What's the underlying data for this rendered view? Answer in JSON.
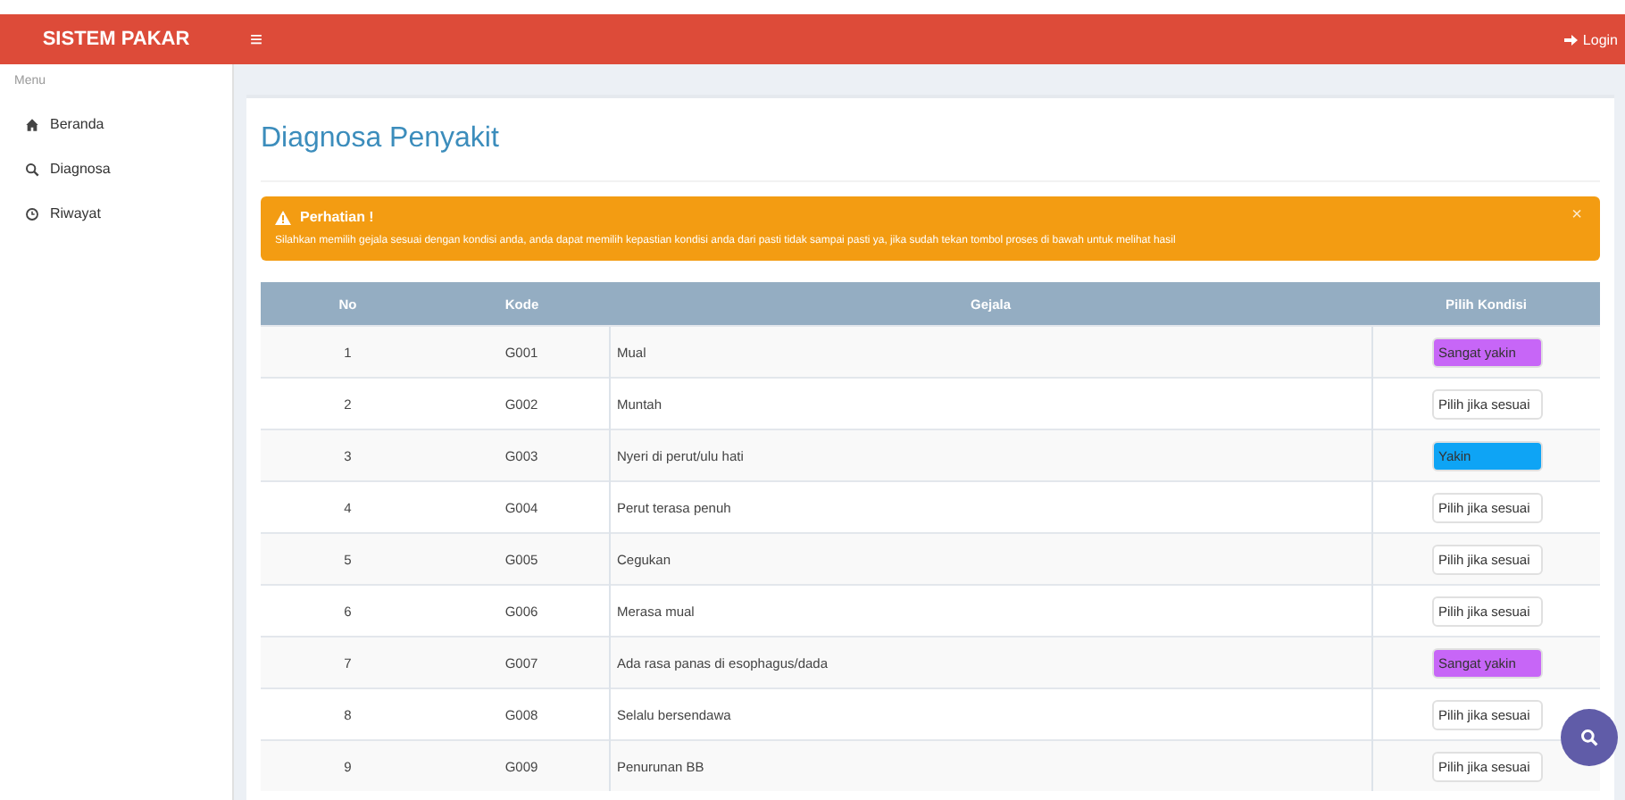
{
  "header": {
    "brand": "SISTEM PAKAR",
    "menu_toggle": "≡",
    "login": "Login"
  },
  "sidebar": {
    "heading": "Menu",
    "items": [
      {
        "label": "Beranda"
      },
      {
        "label": "Diagnosa"
      },
      {
        "label": "Riwayat"
      }
    ]
  },
  "page": {
    "title": "Diagnosa Penyakit"
  },
  "alert": {
    "title": "Perhatian !",
    "close": "×",
    "text": "Silahkan memilih gejala sesuai dengan kondisi anda, anda dapat memilih kepastian kondisi anda dari pasti tidak sampai pasti ya, jika sudah tekan tombol proses di bawah untuk melihat hasil"
  },
  "table": {
    "columns": [
      "No",
      "Kode",
      "Gejala",
      "Pilih Kondisi"
    ],
    "rows": [
      {
        "no": "1",
        "kode": "G001",
        "gejala": "Mual",
        "kondisi": "Sangat yakin",
        "color": "#c766f7"
      },
      {
        "no": "2",
        "kode": "G002",
        "gejala": "Muntah",
        "kondisi": "Pilih jika sesuai",
        "color": "#ffffff"
      },
      {
        "no": "3",
        "kode": "G003",
        "gejala": "Nyeri di perut/ulu hati",
        "kondisi": "Yakin",
        "color": "#0ea4f5"
      },
      {
        "no": "4",
        "kode": "G004",
        "gejala": "Perut terasa penuh",
        "kondisi": "Pilih jika sesuai",
        "color": "#ffffff"
      },
      {
        "no": "5",
        "kode": "G005",
        "gejala": "Cegukan",
        "kondisi": "Pilih jika sesuai",
        "color": "#ffffff"
      },
      {
        "no": "6",
        "kode": "G006",
        "gejala": "Merasa mual",
        "kondisi": "Pilih jika sesuai",
        "color": "#ffffff"
      },
      {
        "no": "7",
        "kode": "G007",
        "gejala": "Ada rasa panas di esophagus/dada",
        "kondisi": "Sangat yakin",
        "color": "#c766f7"
      },
      {
        "no": "8",
        "kode": "G008",
        "gejala": "Selalu bersendawa",
        "kondisi": "Pilih jika sesuai",
        "color": "#ffffff"
      },
      {
        "no": "9",
        "kode": "G009",
        "gejala": "Penurunan BB",
        "kondisi": "Pilih jika sesuai",
        "color": "#ffffff"
      }
    ]
  }
}
